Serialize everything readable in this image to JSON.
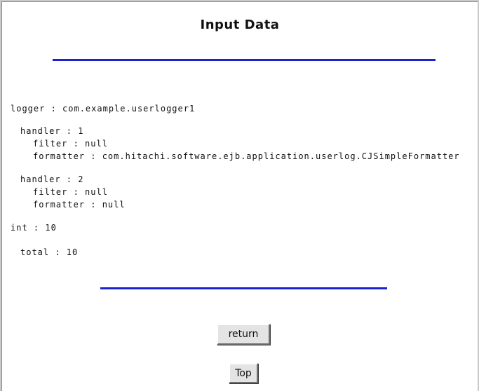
{
  "page": {
    "title": "Input Data"
  },
  "content": {
    "logger": "logger : com.example.userlogger1",
    "handler1": "handler : 1",
    "handler1_filter": "filter : null",
    "handler1_formatter": "formatter : com.hitachi.software.ejb.application.userlog.CJSimpleFormatter",
    "handler2": "handler : 2",
    "handler2_filter": "filter : null",
    "handler2_formatter": "formatter : null",
    "int": "int : 10",
    "total": "total : 10"
  },
  "buttons": {
    "return_label": "return",
    "top_label": "Top"
  },
  "colors": {
    "rule": "#1b22d6",
    "background": "#ffffff"
  }
}
